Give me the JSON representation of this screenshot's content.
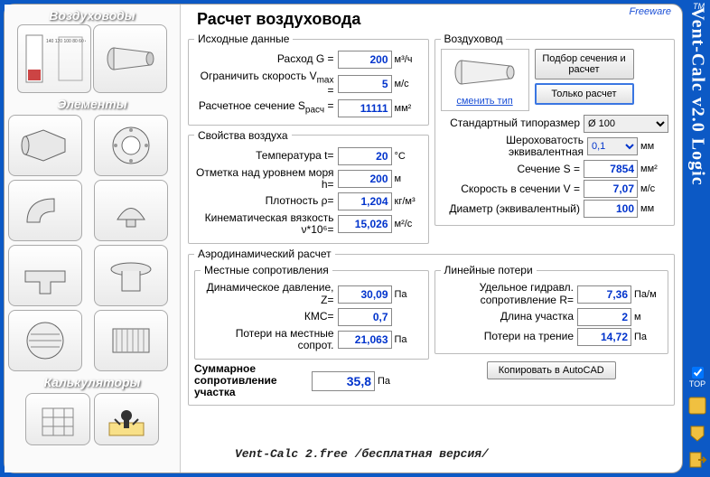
{
  "app": {
    "rail_title": "Vent-Calc v2.0 Logic",
    "freeware": "Freeware",
    "tm": "TM",
    "top_label": "TOP",
    "version_text": "Vent-Calc 2.free /бесплатная версия/"
  },
  "left": {
    "section1": "Воздуховоды",
    "section2": "Элементы",
    "section3": "Калькуляторы"
  },
  "title": "Расчет воздуховода",
  "source": {
    "legend": "Исходные данные",
    "flow_lbl": "Расход G =",
    "flow_val": "200",
    "flow_unit": "м³/ч",
    "vmax_lbl": "Ограничить скорость V",
    "vmax_sub": "max",
    "vmax_val": "5",
    "vmax_unit": "м/с",
    "section_lbl": "Расчетное сечение S",
    "section_sub": "расч",
    "section_val": "11111",
    "section_unit": "мм²"
  },
  "air": {
    "legend": "Свойства воздуха",
    "temp_lbl": "Температура t=",
    "temp_val": "20",
    "temp_unit": "°C",
    "alt_lbl": "Отметка над уровнем моря h=",
    "alt_val": "200",
    "alt_unit": "м",
    "dens_lbl": "Плотность ρ=",
    "dens_val": "1,204",
    "dens_unit": "кг/м³",
    "visc_lbl": "Кинематическая вязкость ν*10⁶=",
    "visc_val": "15,026",
    "visc_unit": "м²/с"
  },
  "duct": {
    "legend": "Воздуховод",
    "change_type": "сменить тип",
    "btn1": "Подбор сечения и расчет",
    "btn2": "Только расчет",
    "size_lbl": "Стандартный типоразмер",
    "size_val": "Ø 100",
    "rough_lbl": "Шероховатость эквивалентная",
    "rough_val": "0,1",
    "rough_unit": "мм",
    "s_lbl": "Сечение S =",
    "s_val": "7854",
    "s_unit": "мм²",
    "v_lbl": "Скорость в сечении V =",
    "v_val": "7,07",
    "v_unit": "м/с",
    "d_lbl": "Диаметр (эквивалентный)",
    "d_val": "100",
    "d_unit": "мм"
  },
  "aero": {
    "legend": "Аэродинамический расчет",
    "local": {
      "legend": "Местные сопротивления",
      "z_lbl": "Динамическое давление, Z=",
      "z_val": "30,09",
      "z_unit": "Па",
      "kms_lbl": "КМС=",
      "kms_val": "0,7",
      "loss_lbl": "Потери на местные сопрот.",
      "loss_val": "21,063",
      "loss_unit": "Па"
    },
    "linear": {
      "legend": "Линейные потери",
      "r_lbl": "Удельное гидравл. сопротивление R=",
      "r_val": "7,36",
      "r_unit": "Па/м",
      "len_lbl": "Длина участка",
      "len_val": "2",
      "len_unit": "м",
      "fric_lbl": "Потери на трение",
      "fric_val": "14,72",
      "fric_unit": "Па"
    },
    "sum_lbl": "Суммарное сопротивление участка",
    "sum_val": "35,8",
    "sum_unit": "Па",
    "copy_btn": "Копировать в AutoCAD"
  }
}
